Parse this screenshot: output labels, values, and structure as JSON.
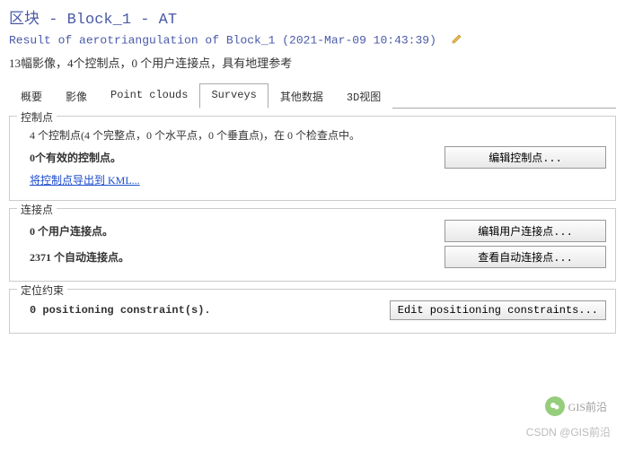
{
  "header": {
    "title": "区块 - Block_1 - AT",
    "subtitle": "Result of aerotriangulation of Block_1 (2021-Mar-09 10:43:39)",
    "summary": "13幅影像，4个控制点，0 个用户连接点，具有地理参考"
  },
  "tabs": {
    "items": [
      "概要",
      "影像",
      "Point clouds",
      "Surveys",
      "其他数据",
      "3D视图"
    ],
    "active": "Surveys"
  },
  "controlPoints": {
    "groupTitle": "控制点",
    "line1": "4 个控制点(4 个完整点，0 个水平点，0 个垂直点)，在 0 个检查点中。",
    "line2": "0个有效的控制点。",
    "link": "将控制点导出到 KML...",
    "button": "编辑控制点..."
  },
  "tiePoints": {
    "groupTitle": "连接点",
    "userLine": "0 个用户连接点。",
    "autoLine": "2371 个自动连接点。",
    "editButton": "编辑用户连接点...",
    "viewButton": "查看自动连接点..."
  },
  "constraints": {
    "groupTitle": "定位约束",
    "line": "0 positioning constraint(s).",
    "button": "Edit positioning constraints..."
  },
  "footer": {
    "logoText": "GIS前沿",
    "watermark": "CSDN @GIS前沿"
  }
}
